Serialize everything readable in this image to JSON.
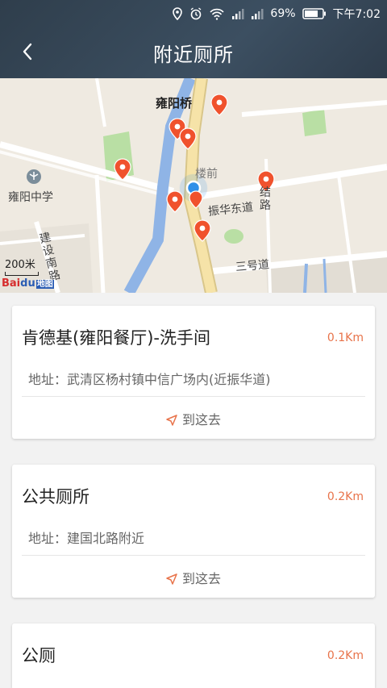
{
  "status_bar": {
    "battery": "69%",
    "time": "下午7:02",
    "icons": [
      "location-icon",
      "alarm-icon",
      "wifi-icon",
      "signal-icon",
      "signal-icon",
      "battery-icon"
    ]
  },
  "header": {
    "title": "附近厕所",
    "back_icon": "chevron-left-icon"
  },
  "map": {
    "labels": {
      "yongyang_bridge": "雍阳桥",
      "louqian": "楼前",
      "yongyang_school": "雍阳中学",
      "zhenhua_road": "振华东道",
      "jianshe_road": "建设南路",
      "jie_road": "结路",
      "sanhao_road": "三号道"
    },
    "scale": "200米",
    "logo": {
      "bai": "Bai",
      "du": "du",
      "suffix": "地图"
    },
    "colors": {
      "pin": "#f0522d",
      "location": "#2f8fe8",
      "water": "#8fb4e6",
      "road": "#ffffff",
      "main_road": "#f6e3a8"
    }
  },
  "toilets": [
    {
      "name": "肯德基(雍阳餐厅)-洗手间",
      "distance": "0.1Km",
      "address": "地址：武清区杨村镇中信广场内(近振华道)",
      "nav_label": "到这去"
    },
    {
      "name": "公共厕所",
      "distance": "0.2Km",
      "address": "地址：建国北路附近",
      "nav_label": "到这去"
    },
    {
      "name": "公厕",
      "distance": "0.2Km"
    }
  ],
  "colors": {
    "accent": "#e8734a",
    "header": "#34485a"
  }
}
